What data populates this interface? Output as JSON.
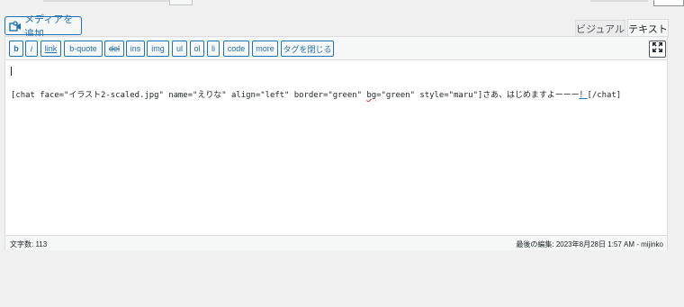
{
  "media": {
    "add_label": "メディアを追加",
    "icon": "media-add-icon"
  },
  "tabs": {
    "visual": "ビジュアル",
    "text": "テキスト"
  },
  "toolbar": {
    "buttons": [
      "b",
      "i",
      "link",
      "b-quote",
      "del",
      "ins",
      "img",
      "ul",
      "ol",
      "li",
      "code",
      "more",
      "タグを閉じる"
    ],
    "fullscreen_icon": "fullscreen-icon"
  },
  "content": {
    "line_a": "[chat face=\"イラスト2-scaled.jpg\" name=\"えりな\" align=\"left\" border=\"green\" ",
    "line_bg": "bg",
    "line_b": "=\"green\" style=\"maru\"]さあ、はじめますよーーー",
    "line_mark": "！",
    "line_c": "[/chat]"
  },
  "status": {
    "word_count": "文字数: 113",
    "last_edited": "最後の編集: 2023年8月28日 1:57 AM - mijinko"
  }
}
